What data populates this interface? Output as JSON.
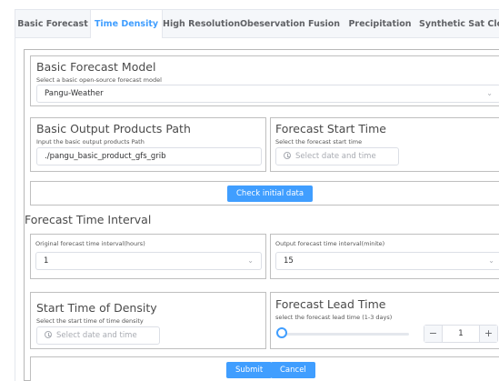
{
  "tabs": [
    "Basic Forecast",
    "Time Density",
    "High Resolution",
    "Obeservation Fusion",
    "Precipitation",
    "Synthetic Sat Cloud"
  ],
  "active_tab": "Time Density",
  "basic_model": {
    "title": "Basic Forecast Model",
    "subtitle": "Select a basic open-source forecast model",
    "value": "Pangu-Weather"
  },
  "output_path": {
    "title": "Basic Output Products Path",
    "subtitle": "Input the basic output products Path",
    "value": "./pangu_basic_product_gfs_grib"
  },
  "start_time": {
    "title": "Forecast Start Time",
    "subtitle": "Select the forecast start time",
    "placeholder": "Select date and time"
  },
  "check_button": "Check initial data",
  "interval": {
    "title": "Forecast Time Interval",
    "original_label": "Original forecast time interval(hours)",
    "original_value": "1",
    "output_label": "Output forecast time interval(minite)",
    "output_value": "15"
  },
  "density_start": {
    "title": "Start Time of Density",
    "subtitle": "Select the start time of time density",
    "placeholder": "Select date and time"
  },
  "lead_time": {
    "title": "Forecast Lead Time",
    "subtitle": "select the forecast lead time (1-3 days)",
    "value": "1",
    "slider_fraction": 0
  },
  "actions": {
    "submit": "Submit",
    "cancel": "Cancel"
  },
  "colors": {
    "accent": "#409eff",
    "border": "#bfbfbf"
  }
}
